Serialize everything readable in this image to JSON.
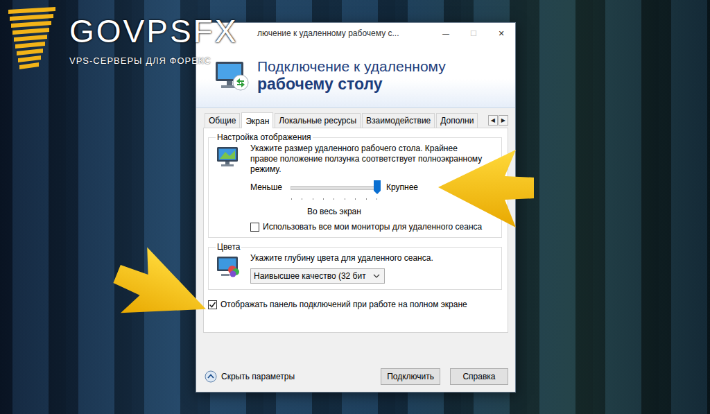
{
  "brand": {
    "name": "GOVPSFX",
    "tagline": "VPS-СЕРВЕРЫ ДЛЯ ФОРЕКС"
  },
  "window": {
    "title": "лючение к удаленному рабочему с...",
    "controls": [
      {
        "glyph": "—",
        "disabled": false
      },
      {
        "glyph": "☐",
        "disabled": true
      },
      {
        "glyph": "✕",
        "disabled": false
      }
    ]
  },
  "header": {
    "line1": "Подключение к удаленному",
    "line2": "рабочему столу"
  },
  "tabs": [
    {
      "label": "Общие",
      "selected": false
    },
    {
      "label": "Экран",
      "selected": true
    },
    {
      "label": "Локальные ресурсы",
      "selected": false
    },
    {
      "label": "Взаимодействие",
      "selected": false
    },
    {
      "label": "Дополни",
      "selected": false
    }
  ],
  "tab_scroll": [
    "◀",
    "▶"
  ],
  "display_group": {
    "title": "Настройка отображения",
    "description": "Укажите размер удаленного рабочего стола. Крайнее правое положение ползунка соответствует полноэкранному режиму.",
    "slider": {
      "min_label": "Меньше",
      "max_label": "Крупнее",
      "level": 1,
      "caption": "Во весь экран"
    },
    "checkbox": {
      "label": "Использовать все мои мониторы для удаленного сеанса",
      "checked": false
    }
  },
  "colors_group": {
    "title": "Цвета",
    "description": "Укажите глубину цвета для удаленного сеанса.",
    "dropdown": {
      "value": "Наивысшее качество (32 бит"
    }
  },
  "connection_bar_checkbox": {
    "label": "Отображать панель подключений при работе на полном экране",
    "checked": true
  },
  "footer": {
    "toggle": "Скрыть параметры",
    "buttons": [
      "Подключить",
      "Справка"
    ]
  }
}
